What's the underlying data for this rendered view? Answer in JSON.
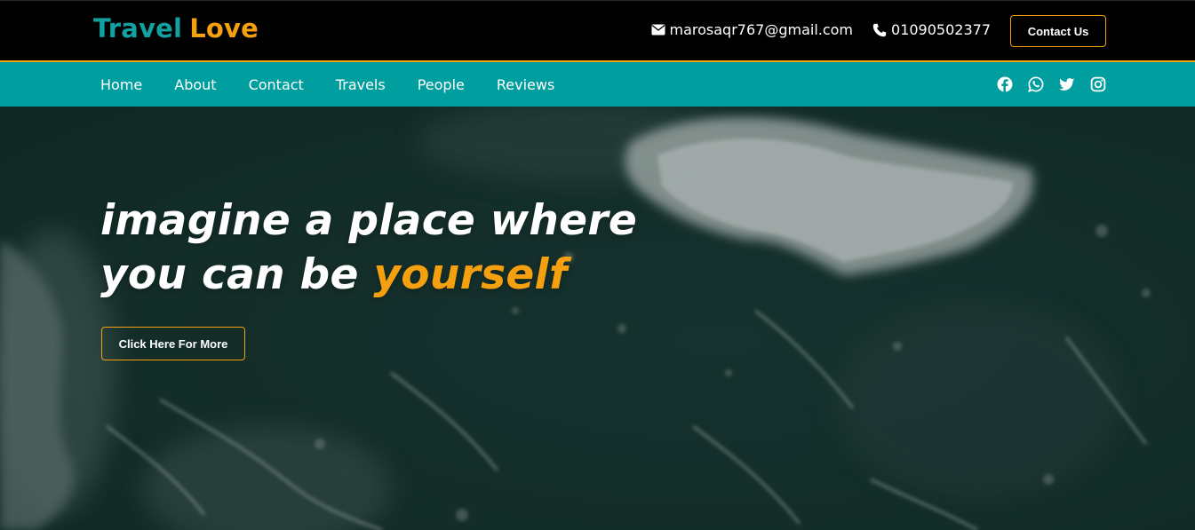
{
  "brand": {
    "word1": "Travel",
    "word2": "Love",
    "teal": "#12a0a0",
    "orange": "#f5a00f"
  },
  "contact": {
    "email": "marosaqr767@gmail.com",
    "email_icon": "envelope-icon",
    "phone": "01090502377",
    "phone_icon": "phone-icon",
    "button_label": "Contact Us"
  },
  "nav": {
    "background": "#009e9e",
    "items": [
      {
        "label": "Home"
      },
      {
        "label": "About"
      },
      {
        "label": "Contact"
      },
      {
        "label": "Travels"
      },
      {
        "label": "People"
      },
      {
        "label": "Reviews"
      }
    ],
    "socials": [
      "facebook-icon",
      "whatsapp-icon",
      "twitter-icon",
      "instagram-icon"
    ]
  },
  "hero": {
    "line1": "imagine a place where",
    "line2_prefix": "you can be",
    "line2_accent": "yourself",
    "button_label": "Click Here For More",
    "background": "aerial ocean waves"
  }
}
